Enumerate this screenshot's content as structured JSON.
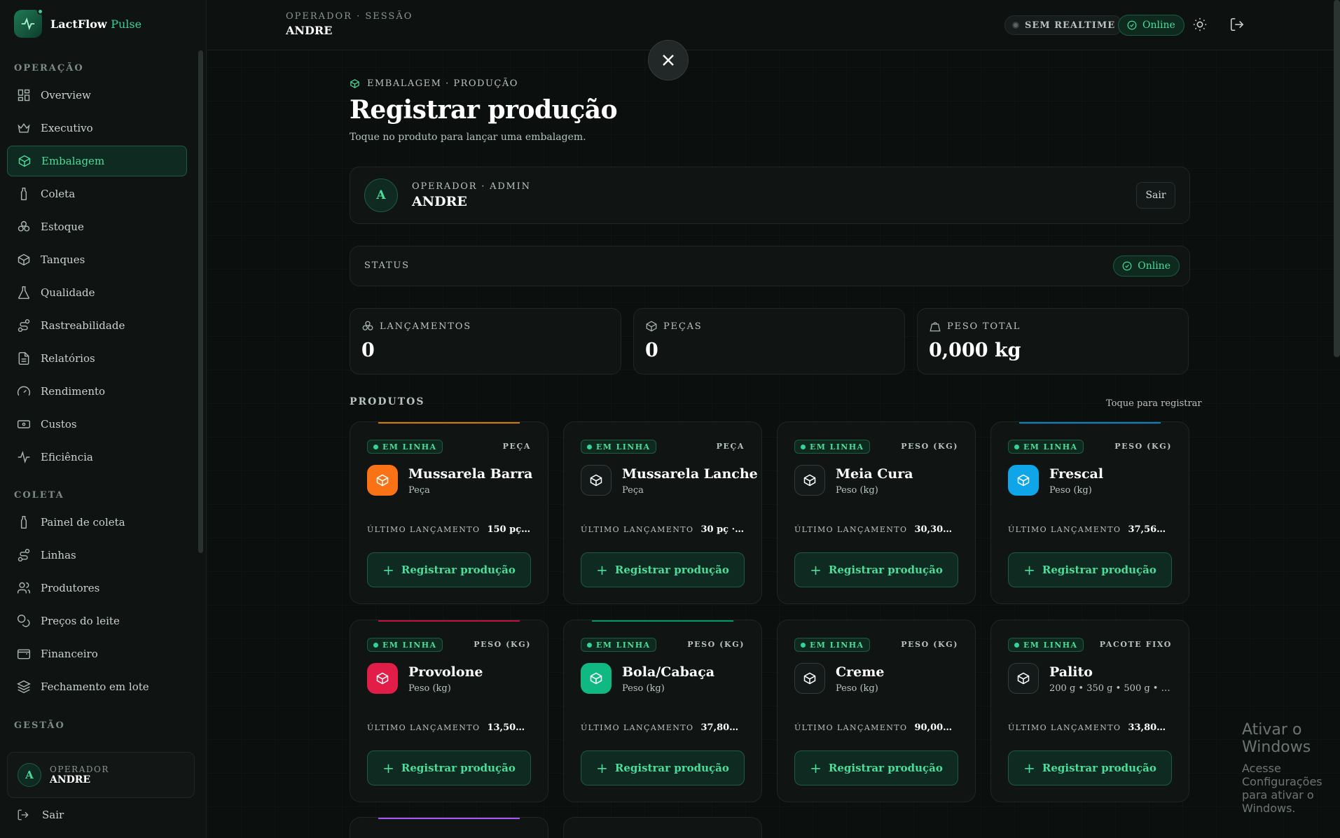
{
  "brand": {
    "name": "LactFlow",
    "sub": "Pulse"
  },
  "sidebar": {
    "sections": [
      {
        "title": "OPERAÇÃO",
        "items": [
          {
            "label": "Overview",
            "icon": "grid-icon"
          },
          {
            "label": "Executivo",
            "icon": "crown-icon"
          },
          {
            "label": "Embalagem",
            "icon": "package-icon",
            "active": true
          },
          {
            "label": "Coleta",
            "icon": "bottle-icon"
          },
          {
            "label": "Estoque",
            "icon": "boxes-icon"
          },
          {
            "label": "Tanques",
            "icon": "cube-icon"
          },
          {
            "label": "Qualidade",
            "icon": "flask-icon"
          },
          {
            "label": "Rastreabilidade",
            "icon": "route-icon"
          },
          {
            "label": "Relatórios",
            "icon": "file-icon"
          },
          {
            "label": "Rendimento",
            "icon": "gauge-icon"
          },
          {
            "label": "Custos",
            "icon": "banknote-icon"
          },
          {
            "label": "Eficiência",
            "icon": "activity-icon"
          }
        ]
      },
      {
        "title": "COLETA",
        "items": [
          {
            "label": "Painel de coleta",
            "icon": "bottle-icon"
          },
          {
            "label": "Linhas",
            "icon": "route-icon"
          },
          {
            "label": "Produtores",
            "icon": "users-icon"
          },
          {
            "label": "Preços do leite",
            "icon": "coins-icon"
          },
          {
            "label": "Financeiro",
            "icon": "wallet-icon"
          },
          {
            "label": "Fechamento em lote",
            "icon": "layers-icon"
          }
        ]
      },
      {
        "title": "GESTÃO",
        "items": []
      }
    ],
    "operator": {
      "initial": "A",
      "label": "OPERADOR",
      "name": "ANDRE"
    },
    "logout": "Sair"
  },
  "topbar": {
    "operator_label": "OPERADOR · SESSÃO",
    "operator_name": "ANDRE",
    "realtime": "SEM REALTIME",
    "online": "Online"
  },
  "page": {
    "breadcrumb": "EMBALAGEM · PRODUÇÃO",
    "title": "Registrar produção",
    "subtitle": "Toque no produto para lançar uma embalagem."
  },
  "operator_panel": {
    "initial": "A",
    "label": "OPERADOR · ADMIN",
    "name": "ANDRE",
    "logout": "Sair"
  },
  "status_panel": {
    "label": "STATUS",
    "value": "Online"
  },
  "stats": [
    {
      "label": "LANÇAMENTOS",
      "value": "0",
      "icon": "boxes-icon"
    },
    {
      "label": "PEÇAS",
      "value": "0",
      "icon": "cube-icon"
    },
    {
      "label": "PESO TOTAL",
      "value": "0,000 kg",
      "icon": "weight-icon"
    }
  ],
  "products_header": {
    "title": "PRODUTOS",
    "hint": "Toque para registrar"
  },
  "products": [
    {
      "status": "EM LINHA",
      "tag": "PEÇA",
      "name": "Mussarela Barra",
      "unit": "Peça",
      "last_label": "ÚLTIMO LANÇAMENTO",
      "last_value": "150 pç · 1...",
      "button": "Registrar produção",
      "color": "#f97316",
      "line": "#d97706"
    },
    {
      "status": "EM LINHA",
      "tag": "PEÇA",
      "name": "Mussarela Lanche",
      "unit": "Peça",
      "last_label": "ÚLTIMO LANÇAMENTO",
      "last_value": "30 pç · 10...",
      "button": "Registrar produção",
      "color": "",
      "line": ""
    },
    {
      "status": "EM LINHA",
      "tag": "PESO (KG)",
      "name": "Meia Cura",
      "unit": "Peso (kg)",
      "last_label": "ÚLTIMO LANÇAMENTO",
      "last_value": "30,300 kg...",
      "button": "Registrar produção",
      "color": "",
      "line": ""
    },
    {
      "status": "EM LINHA",
      "tag": "PESO (KG)",
      "name": "Frescal",
      "unit": "Peso (kg)",
      "last_label": "ÚLTIMO LANÇAMENTO",
      "last_value": "37,560 kg...",
      "button": "Registrar produção",
      "color": "#0ea5e9",
      "line": "#0284c7"
    },
    {
      "status": "EM LINHA",
      "tag": "PESO (KG)",
      "name": "Provolone",
      "unit": "Peso (kg)",
      "last_label": "ÚLTIMO LANÇAMENTO",
      "last_value": "13,500 kg...",
      "button": "Registrar produção",
      "color": "#e11d48",
      "line": "#be123c"
    },
    {
      "status": "EM LINHA",
      "tag": "PESO (KG)",
      "name": "Bola/Cabaça",
      "unit": "Peso (kg)",
      "last_label": "ÚLTIMO LANÇAMENTO",
      "last_value": "37,800 kg...",
      "button": "Registrar produção",
      "color": "#10b981",
      "line": "#059669"
    },
    {
      "status": "EM LINHA",
      "tag": "PESO (KG)",
      "name": "Creme",
      "unit": "Peso (kg)",
      "last_label": "ÚLTIMO LANÇAMENTO",
      "last_value": "90,000 kg...",
      "button": "Registrar produção",
      "color": "",
      "line": ""
    },
    {
      "status": "EM LINHA",
      "tag": "PACOTE FIXO",
      "name": "Palito",
      "unit": "200 g • 350 g • 500 g • 1 kg • ...",
      "last_label": "ÚLTIMO LANÇAMENTO",
      "last_value": "33,800 kg...",
      "button": "Registrar produção",
      "color": "",
      "line": ""
    }
  ],
  "watermark": {
    "title": "Ativar o Windows",
    "text": "Acesse Configurações para ativar o Windows."
  }
}
